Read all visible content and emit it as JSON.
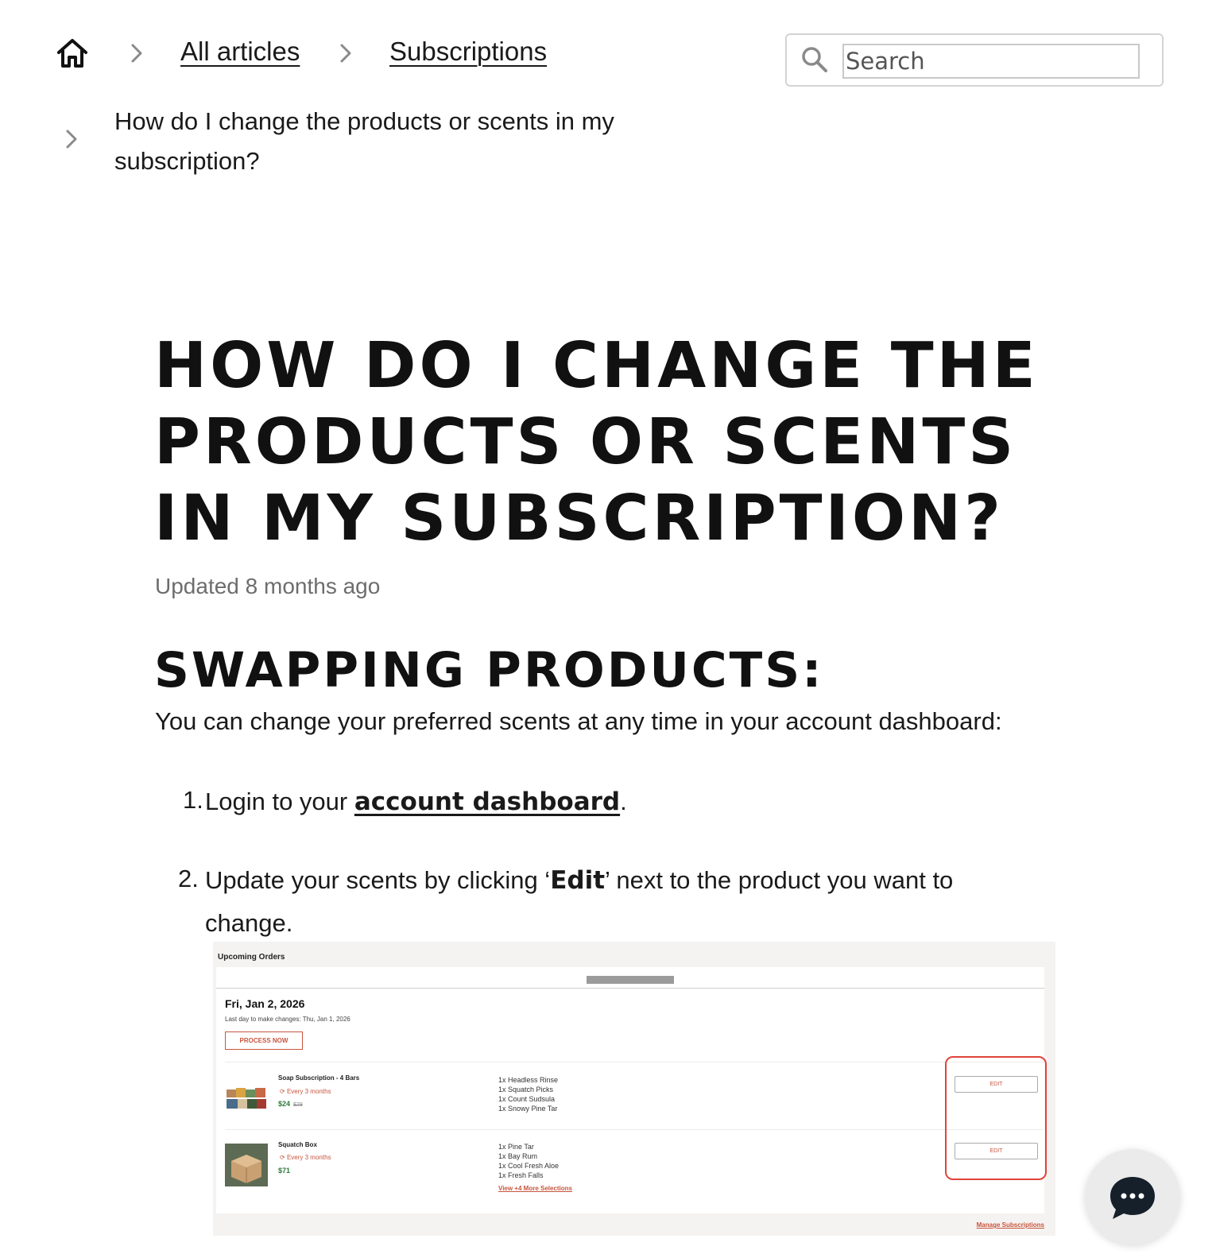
{
  "breadcrumb": {
    "home_icon": "home-icon",
    "items": [
      "All articles",
      "Subscriptions"
    ],
    "current_line1": "How do I change the products or scents in my",
    "current_line2": "subscription?"
  },
  "search": {
    "placeholder": "Search",
    "icon": "search-icon"
  },
  "article": {
    "title_line1": "How do I change the",
    "title_line2": "products or scents",
    "title_line3": "in my subscription?",
    "updated": "Updated 8 months ago",
    "section_heading": "Swapping products:",
    "intro": "You can change your preferred scents at any time in your account dashboard:",
    "steps": [
      {
        "num": "1.",
        "before": "Login to your ",
        "link": "account dashboard",
        "after": "."
      },
      {
        "num": "2.",
        "before": "Update your scents by clicking ‘",
        "bold": "Edit",
        "after": "’ next to the product you want to",
        "line2": "change."
      }
    ]
  },
  "screenshot": {
    "title": "Upcoming Orders",
    "date": "Fri, Jan 2, 2026",
    "last_day": "Last day to make changes: Thu, Jan 1, 2026",
    "process_button": "PROCESS NOW",
    "products": [
      {
        "name": "Soap Subscription - 4 Bars",
        "frequency": "Every 3 months",
        "price": "$24",
        "old_price": "$29",
        "items": [
          "1x Headless Rinse",
          "1x Squatch Picks",
          "1x Count Sudsula",
          "1x Snowy Pine Tar"
        ],
        "edit": "EDIT"
      },
      {
        "name": "Squatch Box",
        "frequency": "Every 3 months",
        "price": "$71",
        "items": [
          "1x Pine Tar",
          "1x Bay Rum",
          "1x Cool Fresh Aloe",
          "1x Fresh Falls"
        ],
        "more": "View +4 More Selections",
        "edit": "EDIT"
      }
    ],
    "manage_link": "Manage Subscriptions"
  },
  "chat": {
    "icon": "chat-bubble-icon"
  },
  "colors": {
    "accent": "#c8553d",
    "highlight": "#e0443a",
    "text": "#1a1a1a",
    "muted": "#6d6d6d"
  }
}
